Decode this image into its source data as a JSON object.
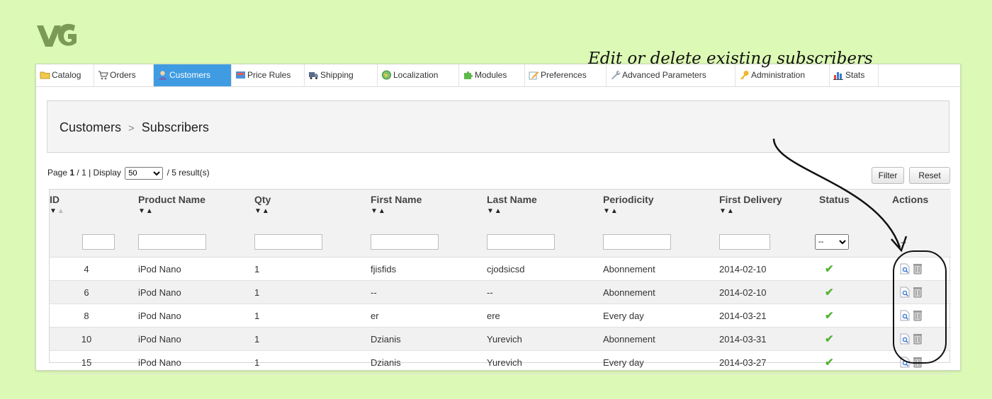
{
  "nav": {
    "tabs": [
      {
        "label": "Catalog",
        "icon": "folder-icon",
        "active": false
      },
      {
        "label": "Orders",
        "icon": "cart-icon",
        "active": false
      },
      {
        "label": "Customers",
        "icon": "user-icon",
        "active": true
      },
      {
        "label": "Price Rules",
        "icon": "price-tag-icon",
        "active": false
      },
      {
        "label": "Shipping",
        "icon": "truck-icon",
        "active": false
      },
      {
        "label": "Localization",
        "icon": "globe-icon",
        "active": false
      },
      {
        "label": "Modules",
        "icon": "puzzle-icon",
        "active": false
      },
      {
        "label": "Preferences",
        "icon": "pencil-icon",
        "active": false
      },
      {
        "label": "Advanced Parameters",
        "icon": "wrench-icon",
        "active": false
      },
      {
        "label": "Administration",
        "icon": "key-icon",
        "active": false
      },
      {
        "label": "Stats",
        "icon": "bar-chart-icon",
        "active": false
      }
    ]
  },
  "breadcrumb": {
    "parent": "Customers",
    "separator": ">",
    "current": "Subscribers"
  },
  "annotation": "Edit or delete existing subscribers",
  "pagination": {
    "page_label": "Page",
    "page": "1",
    "total_pages": "/ 1",
    "display_label": "| Display",
    "display_value": "50",
    "results": "/ 5 result(s)"
  },
  "toolbar": {
    "filter_label": "Filter",
    "reset_label": "Reset"
  },
  "table": {
    "columns": [
      "ID",
      "Product Name",
      "Qty",
      "First Name",
      "Last Name",
      "Periodicity",
      "First Delivery",
      "Status",
      "Actions"
    ],
    "status_filter_value": "--",
    "actions_filter_value": "--",
    "rows": [
      {
        "id": "4",
        "product": "iPod Nano",
        "qty": "1",
        "first": "fjisfids",
        "last": "cjodsicsd",
        "periodicity": "Abonnement",
        "delivery": "2014-02-10",
        "status": "✔"
      },
      {
        "id": "6",
        "product": "iPod Nano",
        "qty": "1",
        "first": "--",
        "last": "--",
        "periodicity": "Abonnement",
        "delivery": "2014-02-10",
        "status": "✔"
      },
      {
        "id": "8",
        "product": "iPod Nano",
        "qty": "1",
        "first": "er",
        "last": "ere",
        "periodicity": "Every day",
        "delivery": "2014-03-21",
        "status": "✔"
      },
      {
        "id": "10",
        "product": "iPod Nano",
        "qty": "1",
        "first": "Dzianis",
        "last": "Yurevich",
        "periodicity": "Abonnement",
        "delivery": "2014-03-31",
        "status": "✔"
      },
      {
        "id": "15",
        "product": "iPod Nano",
        "qty": "1",
        "first": "Dzianis",
        "last": "Yurevich",
        "periodicity": "Every day",
        "delivery": "2014-03-27",
        "status": "✔"
      }
    ]
  },
  "colors": {
    "background": "#dcf9b5",
    "active_tab": "#3f9ce2",
    "check": "#55b236"
  }
}
